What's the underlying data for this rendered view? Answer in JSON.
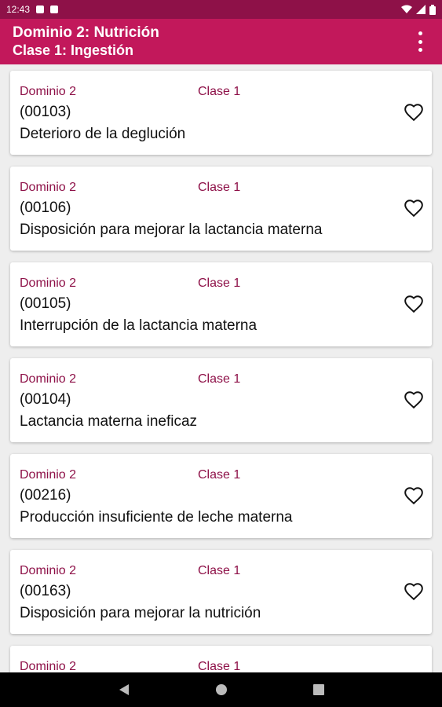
{
  "status": {
    "time": "12:43"
  },
  "appbar": {
    "title": "Dominio 2: Nutrición",
    "subtitle": "Clase 1: Ingestión"
  },
  "items": [
    {
      "dominio": "Dominio 2",
      "clase": "Clase 1",
      "code": "(00103)",
      "name": "Deterioro de la deglución"
    },
    {
      "dominio": "Dominio 2",
      "clase": "Clase 1",
      "code": "(00106)",
      "name": "Disposición para mejorar la lactancia materna"
    },
    {
      "dominio": "Dominio 2",
      "clase": "Clase 1",
      "code": "(00105)",
      "name": "Interrupción de la lactancia materna"
    },
    {
      "dominio": "Dominio 2",
      "clase": "Clase 1",
      "code": "(00104)",
      "name": "Lactancia materna ineficaz"
    },
    {
      "dominio": "Dominio 2",
      "clase": "Clase 1",
      "code": "(00216)",
      "name": "Producción insuficiente de leche materna"
    },
    {
      "dominio": "Dominio 2",
      "clase": "Clase 1",
      "code": "(00163)",
      "name": "Disposición para mejorar la nutrición"
    },
    {
      "dominio": "Dominio 2",
      "clase": "Clase 1"
    }
  ],
  "colors": {
    "primary": "#c2185b",
    "primary_dark": "#8e1148",
    "label": "#8e1148"
  }
}
